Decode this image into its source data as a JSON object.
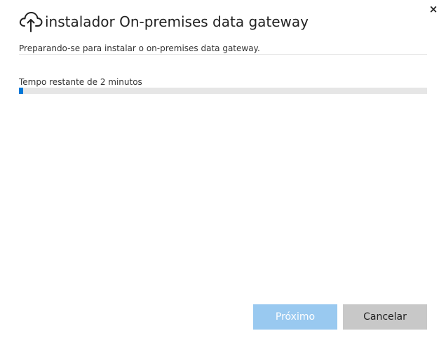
{
  "window": {
    "close_glyph": "×",
    "close_icon": "close-icon"
  },
  "header": {
    "logo_icon": "cloud-upload-icon",
    "title": "instalador On-premises data gateway"
  },
  "status": {
    "message": "Preparando-se para instalar o on-premises data gateway."
  },
  "progress": {
    "label": "Tempo restante de 2 minutos",
    "percent": 1,
    "fill_color": "#0078d7",
    "track_color": "#e6e6e6"
  },
  "buttons": {
    "next_label": "Próximo",
    "next_disabled": true,
    "cancel_label": "Cancelar"
  }
}
